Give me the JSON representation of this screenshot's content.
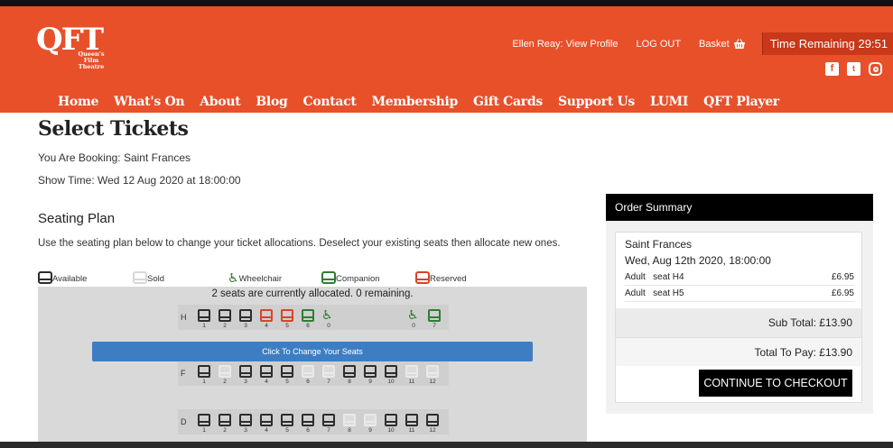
{
  "header": {
    "logo_text": "QFT",
    "logo_subtitle": "Queen's Film Theatre",
    "profile_link": "Ellen Reay: View Profile",
    "logout": "LOG OUT",
    "basket": "Basket",
    "timer": "Time Remaining 29:51",
    "social": [
      "facebook-icon",
      "twitter-icon",
      "instagram-icon"
    ],
    "nav": [
      "Home",
      "What's On",
      "About",
      "Blog",
      "Contact",
      "Membership",
      "Gift Cards",
      "Support Us",
      "LUMI",
      "QFT Player"
    ]
  },
  "main": {
    "title": "Select Tickets",
    "booking": "You Are Booking: Saint Frances",
    "showtime": "Show Time: Wed 12 Aug 2020 at 18:00:00",
    "seating_heading": "Seating Plan",
    "seating_desc": "Use the seating plan below to change your ticket allocations. Deselect your existing seats then allocate new ones."
  },
  "legend": {
    "available": "Available",
    "sold": "Sold",
    "wheelchair": "Wheelchair",
    "companion": "Companion",
    "reserved": "Reserved"
  },
  "plan": {
    "message": "2 seats are currently allocated. 0 remaining.",
    "change_button": "Click To Change Your Seats",
    "rows": {
      "H": {
        "label": "H",
        "numbers": [
          "1",
          "2",
          "3",
          "4",
          "5",
          "6",
          "0",
          "0",
          "7"
        ]
      },
      "F": {
        "label": "F",
        "numbers": [
          "1",
          "2",
          "3",
          "4",
          "5",
          "6",
          "7",
          "8",
          "9",
          "10",
          "11",
          "12"
        ]
      },
      "D": {
        "label": "D",
        "numbers": [
          "1",
          "2",
          "3",
          "4",
          "5",
          "6",
          "7",
          "8",
          "9",
          "10",
          "11",
          "12"
        ]
      }
    }
  },
  "summary": {
    "heading": "Order Summary",
    "film": "Saint Frances",
    "datetime": "Wed, Aug 12th 2020, 18:00:00",
    "lines": [
      {
        "desc": "Adult   seat H4",
        "price": "£6.95"
      },
      {
        "desc": "Adult   seat H5",
        "price": "£6.95"
      }
    ],
    "subtotal": "Sub Total: £13.90",
    "total": "Total To Pay: £13.90",
    "checkout": "CONTINUE TO CHECKOUT"
  },
  "colors": {
    "brand": "#e8502a",
    "available": "#2d2d2d",
    "reserved": "#d9432b",
    "companion": "#2f7d32",
    "button": "#3d7ec3"
  }
}
